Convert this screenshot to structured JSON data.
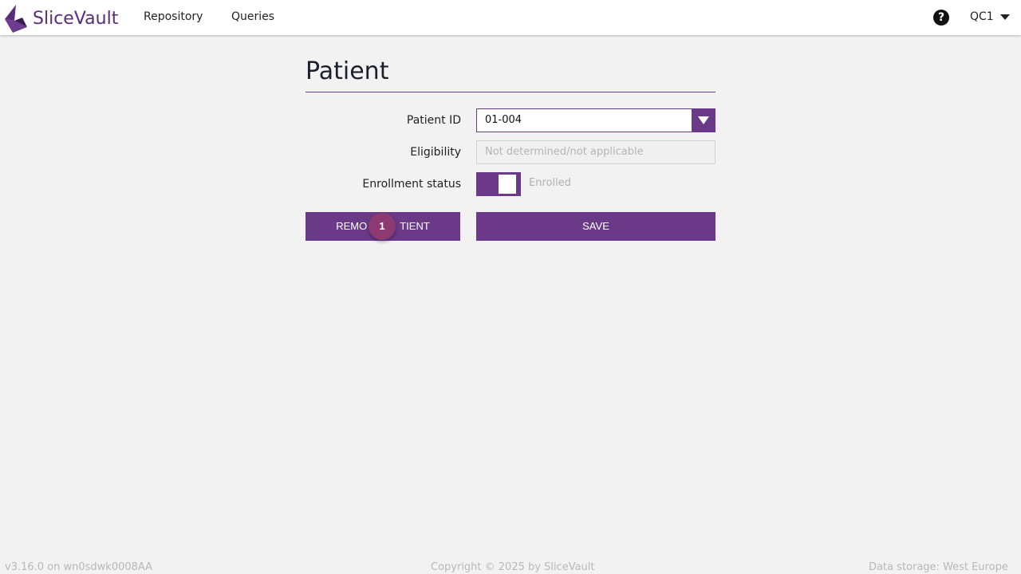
{
  "header": {
    "brand": "SliceVault",
    "nav": [
      {
        "label": "Repository"
      },
      {
        "label": "Queries"
      }
    ],
    "help_icon": "?",
    "user_label": "QC1",
    "icons": {
      "logo": "slicevault-logo-icon",
      "help": "help-icon",
      "user_caret": "caret-down-icon"
    }
  },
  "main": {
    "title": "Patient",
    "fields": {
      "patient_id_label": "Patient ID",
      "patient_id_value": "01-004",
      "eligibility_label": "Eligibility",
      "eligibility_value": "Not determined/not applicable",
      "enrollment_label": "Enrollment status",
      "enrollment_value": "Enrolled",
      "enrollment_on": true
    },
    "buttons": {
      "remove_visible_prefix": "REMO",
      "remove_visible_suffix": "TIENT",
      "save": "SAVE"
    },
    "step_badge": "1"
  },
  "footer": {
    "version": "v3.16.0 on wn0sdwk0008AA",
    "copyright": "Copyright © 2025 by SliceVault",
    "storage": "Data storage: West Europe"
  },
  "colors": {
    "accent": "#6a3a89",
    "background": "#f2f2f2",
    "badge": "#8d3a72"
  }
}
